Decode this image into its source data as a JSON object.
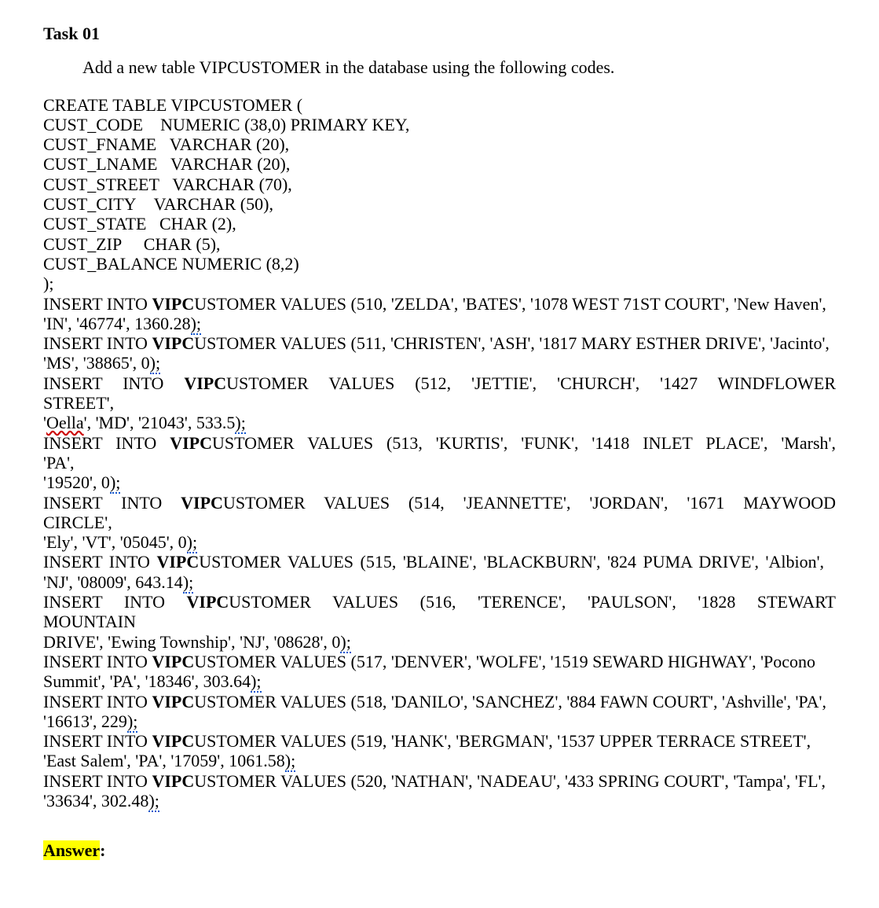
{
  "task": {
    "title": "Task 01",
    "instruction": "Add a new table VIPCUSTOMER in the database using the following codes."
  },
  "create": {
    "l1": "CREATE TABLE VIPCUSTOMER (",
    "l2a": "CUST_CODE",
    "l2b": "NUMERIC (38,0) PRIMARY KEY,",
    "l3a": "CUST_FNAME",
    "l3b": "VARCHAR (20),",
    "l4a": "CUST_LNAME",
    "l4b": "VARCHAR (20),",
    "l5a": "CUST_STREET",
    "l5b": "VARCHAR (70),",
    "l6a": "CUST_CITY",
    "l6b": "VARCHAR (50),",
    "l7a": "CUST_STATE",
    "l7b": "CHAR (2),",
    "l8a": "CUST_ZIP",
    "l8b": "CHAR (5),",
    "l9": "CUST_BALANCE NUMERIC (8,2)",
    "l10": ");"
  },
  "ins": {
    "r1a": "INSERT INTO ",
    "r1b": "VIPC",
    "r1c": "USTOMER VALUES (510, 'ZELDA', 'BATES', '1078 WEST 71ST COURT', 'New Haven',",
    "r1d": "'IN', '46774', 1360.28",
    "r1e": ");",
    "r2a": "INSERT INTO ",
    "r2b": "VIPC",
    "r2c": "USTOMER VALUES (511, 'CHRISTEN', 'ASH', '1817 MARY ESTHER DRIVE', 'Jacinto',",
    "r2d": "'MS', '38865', 0",
    "r2e": ");",
    "r3a": "INSERT INTO ",
    "r3b": "VIPC",
    "r3c": "USTOMER VALUES (512, 'JETTIE', 'CHURCH', '1427 WINDFLOWER STREET',",
    "r3d1": "'",
    "r3d2": "Oella",
    "r3d3": "', 'MD', '21043', 533.5",
    "r3e": ");",
    "r4a": "INSERT INTO ",
    "r4b": "VIPC",
    "r4c": "USTOMER VALUES (513, 'KURTIS', 'FUNK', '1418 INLET PLACE', 'Marsh', 'PA',",
    "r4d": "'19520', 0",
    "r4e": ");",
    "r5a": "INSERT INTO ",
    "r5b": "VIPC",
    "r5c": "USTOMER VALUES (514, 'JEANNETTE', 'JORDAN', '1671 MAYWOOD CIRCLE',",
    "r5d": "'Ely', 'VT', '05045', 0",
    "r5e": ");",
    "r6a": "INSERT INTO ",
    "r6b": "VIPC",
    "r6c": "USTOMER VALUES (515, 'BLAINE', 'BLACKBURN', '824 PUMA DRIVE', 'Albion',",
    "r6d": "'NJ', '08009', 643.14",
    "r6e": ");",
    "r7a": "INSERT INTO ",
    "r7b": "VIPC",
    "r7c": "USTOMER VALUES (516, 'TERENCE', 'PAULSON', '1828 STEWART MOUNTAIN",
    "r7d": "DRIVE', 'Ewing Township', 'NJ', '08628', 0",
    "r7e": ");",
    "r8a": "INSERT INTO ",
    "r8b": "VIPC",
    "r8c": "USTOMER VALUES (517, 'DENVER', 'WOLFE', '1519 SEWARD HIGHWAY', 'Pocono",
    "r8d": "Summit', 'PA', '18346', 303.64",
    "r8e": ");",
    "r9a": "INSERT INTO ",
    "r9b": "VIPC",
    "r9c": "USTOMER VALUES (518, 'DANILO', 'SANCHEZ', '884 FAWN COURT', 'Ashville', 'PA',",
    "r9d": "'16613', 229",
    "r9e": ");",
    "r10a": "INSERT INTO ",
    "r10b": "VIPC",
    "r10c": "USTOMER VALUES (519, 'HANK', 'BERGMAN', '1537 UPPER TERRACE STREET',",
    "r10d": "'East Salem', 'PA', '17059', 1061.58",
    "r10e": ");",
    "r11a": "INSERT INTO ",
    "r11b": "VIPC",
    "r11c": "USTOMER VALUES (520, 'NATHAN', 'NADEAU', '433 SPRING COURT', 'Tampa', 'FL',",
    "r11d": "'33634', 302.48",
    "r11e": ");"
  },
  "answer": {
    "label": "Answer",
    "colon": ":"
  }
}
